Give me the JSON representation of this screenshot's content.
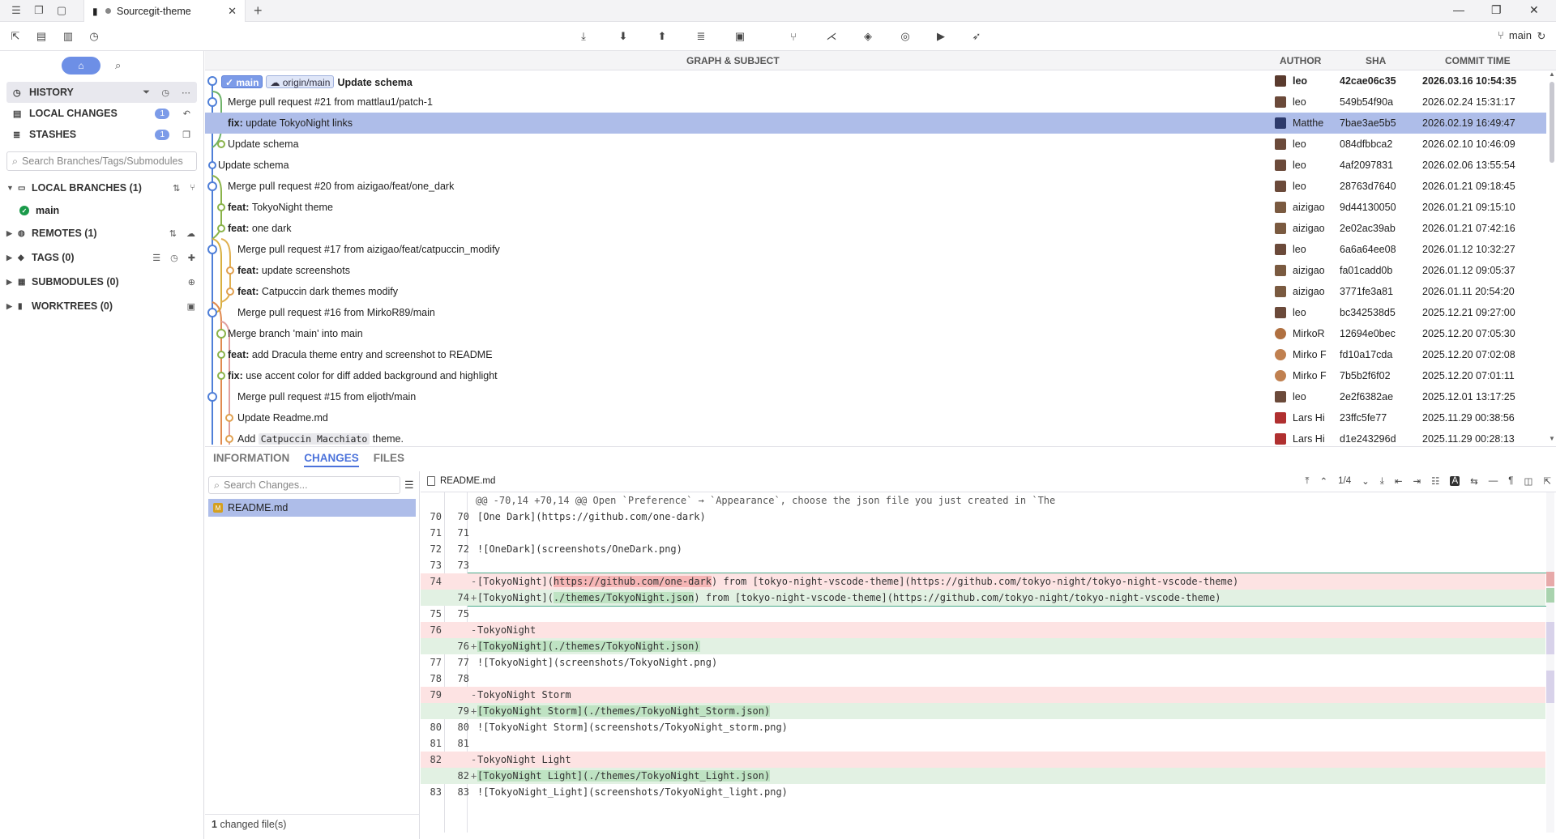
{
  "window": {
    "tab_title": "Sourcegit-theme"
  },
  "toolbar": {
    "current_branch": "main"
  },
  "sidebar": {
    "nav": [
      {
        "label": "HISTORY",
        "badge": null
      },
      {
        "label": "LOCAL CHANGES",
        "badge": "1"
      },
      {
        "label": "STASHES",
        "badge": "1"
      }
    ],
    "search_placeholder": "Search Branches/Tags/Submodules",
    "local_branches": "LOCAL BRANCHES (1)",
    "branch_main": "main",
    "remotes": "REMOTES (1)",
    "tags": "TAGS (0)",
    "submodules": "SUBMODULES (0)",
    "worktrees": "WORKTREES (0)"
  },
  "history": {
    "columns": {
      "graph": "GRAPH & SUBJECT",
      "author": "AUTHOR",
      "sha": "SHA",
      "time": "COMMIT TIME"
    },
    "head_refs": {
      "local": "main",
      "remote": "origin/main"
    },
    "commits": [
      {
        "prefix": "",
        "subject": "Update schema",
        "author": "leo",
        "sha": "42cae06c35",
        "time": "2026.03.16 10:54:35"
      },
      {
        "prefix": "",
        "subject": "Merge pull request #21 from mattlau1/patch-1",
        "author": "leo",
        "sha": "549b54f90a",
        "time": "2026.02.24 15:31:17"
      },
      {
        "prefix": "fix:",
        "subject": "update TokyoNight links",
        "author": "Matthe",
        "sha": "7bae3ae5b5",
        "time": "2026.02.19 16:49:47"
      },
      {
        "prefix": "",
        "subject": "Update schema",
        "author": "leo",
        "sha": "084dfbbca2",
        "time": "2026.02.10 10:46:09"
      },
      {
        "prefix": "",
        "subject": "Update schema",
        "author": "leo",
        "sha": "4af2097831",
        "time": "2026.02.06 13:55:54"
      },
      {
        "prefix": "",
        "subject": "Merge pull request #20 from aizigao/feat/one_dark",
        "author": "leo",
        "sha": "28763d7640",
        "time": "2026.01.21 09:18:45"
      },
      {
        "prefix": "feat:",
        "subject": "TokyoNight theme",
        "author": "aizigao",
        "sha": "9d44130050",
        "time": "2026.01.21 09:15:10"
      },
      {
        "prefix": "feat:",
        "subject": "one dark",
        "author": "aizigao",
        "sha": "2e02ac39ab",
        "time": "2026.01.21 07:42:16"
      },
      {
        "prefix": "",
        "subject": "Merge pull request #17 from aizigao/feat/catpuccin_modify",
        "author": "leo",
        "sha": "6a6a64ee08",
        "time": "2026.01.12 10:32:27"
      },
      {
        "prefix": "feat:",
        "subject": "update screenshots",
        "author": "aizigao",
        "sha": "fa01cadd0b",
        "time": "2026.01.12 09:05:37"
      },
      {
        "prefix": "feat:",
        "subject": "Catpuccin dark themes modify",
        "author": "aizigao",
        "sha": "3771fe3a81",
        "time": "2026.01.11 20:54:20"
      },
      {
        "prefix": "",
        "subject": "Merge pull request #16 from MirkoR89/main",
        "author": "leo",
        "sha": "bc342538d5",
        "time": "2025.12.21 09:27:00"
      },
      {
        "prefix": "",
        "subject": "Merge branch 'main' into main",
        "author": "MirkoR",
        "sha": "12694e0bec",
        "time": "2025.12.20 07:05:30"
      },
      {
        "prefix": "feat:",
        "subject": "add Dracula theme entry and screenshot to README",
        "author": "Mirko F",
        "sha": "fd10a17cda",
        "time": "2025.12.20 07:02:08"
      },
      {
        "prefix": "fix:",
        "subject": "use accent color for diff added background and highlight",
        "author": "Mirko F",
        "sha": "7b5b2f6f02",
        "time": "2025.12.20 07:01:11"
      },
      {
        "prefix": "",
        "subject": "Merge pull request #15 from eljoth/main",
        "author": "leo",
        "sha": "2e2f6382ae",
        "time": "2025.12.01 13:17:25"
      },
      {
        "prefix": "",
        "subject": "Update Readme.md",
        "author": "Lars Hi",
        "sha": "23ffc5fe77",
        "time": "2025.11.29 00:38:56"
      },
      {
        "prefix": "",
        "subject": "Add",
        "code": "Catpuccin Macchiato",
        "suffix": "theme.",
        "author": "Lars Hi",
        "sha": "d1e243296d",
        "time": "2025.11.29 00:28:13"
      }
    ]
  },
  "detail": {
    "tabs": [
      "INFORMATION",
      "CHANGES",
      "FILES"
    ],
    "search_placeholder": "Search Changes...",
    "file": "README.md",
    "footer_count": "1",
    "footer_text": "changed file(s)",
    "nav_counter": "1/4"
  },
  "diff": [
    {
      "type": "hunk",
      "o": "",
      "n": "",
      "text": "@@ -70,14 +70,14 @@ Open `Preference` → `Appearance`, choose the json file you just created in `The"
    },
    {
      "type": "ctx",
      "o": "70",
      "n": "70",
      "text": "[One Dark](https://github.com/one-dark)"
    },
    {
      "type": "ctx",
      "o": "71",
      "n": "71",
      "text": ""
    },
    {
      "type": "ctx",
      "o": "72",
      "n": "72",
      "text": "![OneDark](screenshots/OneDark.png)"
    },
    {
      "type": "ctx",
      "o": "73",
      "n": "73",
      "text": ""
    },
    {
      "type": "del",
      "o": "74",
      "n": "",
      "pre": "[TokyoNight](",
      "hl": "https://github.com/one-dark",
      "post": ") from [tokyo-night-vscode-theme](https://github.com/tokyo-night/tokyo-night-vscode-theme)"
    },
    {
      "type": "add",
      "o": "",
      "n": "74",
      "pre": "[TokyoNight](",
      "hl": "./themes/TokyoNight.json",
      "post": ") from [tokyo-night-vscode-theme](https://github.com/tokyo-night/tokyo-night-vscode-theme)"
    },
    {
      "type": "ctx",
      "o": "75",
      "n": "75",
      "text": ""
    },
    {
      "type": "del",
      "o": "76",
      "n": "",
      "pre": "TokyoNight",
      "hl": "",
      "post": ""
    },
    {
      "type": "add",
      "o": "",
      "n": "76",
      "pre": "",
      "hl": "[TokyoNight](./themes/TokyoNight.json)",
      "post": ""
    },
    {
      "type": "ctx",
      "o": "77",
      "n": "77",
      "text": "![TokyoNight](screenshots/TokyoNight.png)"
    },
    {
      "type": "ctx",
      "o": "78",
      "n": "78",
      "text": ""
    },
    {
      "type": "del",
      "o": "79",
      "n": "",
      "pre": "TokyoNight Storm",
      "hl": "",
      "post": ""
    },
    {
      "type": "add",
      "o": "",
      "n": "79",
      "pre": "",
      "hl": "[TokyoNight Storm](./themes/TokyoNight_Storm.json)",
      "post": ""
    },
    {
      "type": "ctx",
      "o": "80",
      "n": "80",
      "text": "![TokyoNight Storm](screenshots/TokyoNight_storm.png)"
    },
    {
      "type": "ctx",
      "o": "81",
      "n": "81",
      "text": ""
    },
    {
      "type": "del",
      "o": "82",
      "n": "",
      "pre": "TokyoNight Light",
      "hl": "",
      "post": ""
    },
    {
      "type": "add",
      "o": "",
      "n": "82",
      "pre": "",
      "hl": "[TokyoNight Light](./themes/TokyoNight_Light.json)",
      "post": ""
    },
    {
      "type": "ctx",
      "o": "83",
      "n": "83",
      "text": "![TokyoNight_Light](screenshots/TokyoNight_light.png)"
    }
  ],
  "colors": {
    "accent": "#4c73db",
    "selection": "#aebde9",
    "badge": "#7c9be8",
    "diff_del": "#fde3e3",
    "diff_add": "#e2f1e3"
  }
}
